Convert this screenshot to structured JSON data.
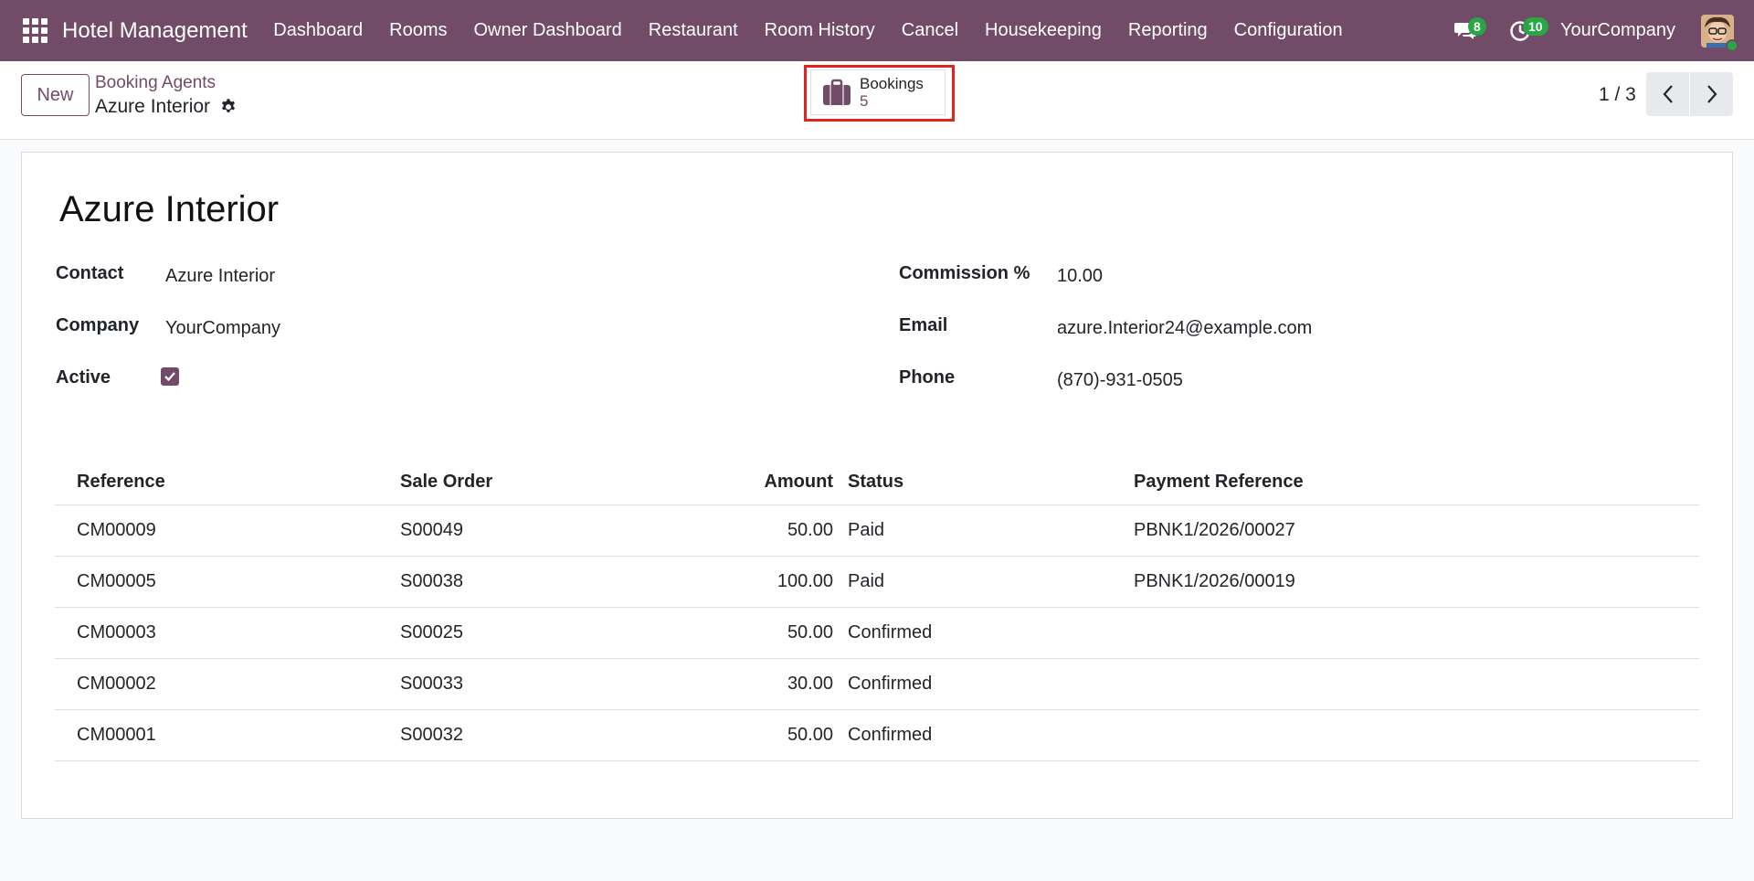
{
  "navbar": {
    "app_name": "Hotel Management",
    "menu": [
      "Dashboard",
      "Rooms",
      "Owner Dashboard",
      "Restaurant",
      "Room History",
      "Cancel",
      "Housekeeping",
      "Reporting",
      "Configuration"
    ],
    "messages_count": "8",
    "activities_count": "10",
    "company": "YourCompany"
  },
  "control_panel": {
    "new_label": "New",
    "breadcrumb_parent": "Booking Agents",
    "breadcrumb_current": "Azure Interior",
    "smart_button": {
      "label": "Bookings",
      "count": "5",
      "icon": "briefcase-icon"
    },
    "pager": "1 / 3"
  },
  "form": {
    "title": "Azure Interior",
    "contact_label": "Contact",
    "contact_value": "Azure Interior",
    "company_label": "Company",
    "company_value": "YourCompany",
    "active_label": "Active",
    "active_value": true,
    "commission_label": "Commission %",
    "commission_value": "10.00",
    "email_label": "Email",
    "email_value": "azure.Interior24@example.com",
    "phone_label": "Phone",
    "phone_value": "(870)-931-0505"
  },
  "table": {
    "headers": {
      "reference": "Reference",
      "sale_order": "Sale Order",
      "amount": "Amount",
      "status": "Status",
      "payment_reference": "Payment Reference"
    },
    "rows": [
      {
        "reference": "CM00009",
        "sale_order": "S00049",
        "amount": "50.00",
        "status": "Paid",
        "payment_reference": "PBNK1/2026/00027"
      },
      {
        "reference": "CM00005",
        "sale_order": "S00038",
        "amount": "100.00",
        "status": "Paid",
        "payment_reference": "PBNK1/2026/00019"
      },
      {
        "reference": "CM00003",
        "sale_order": "S00025",
        "amount": "50.00",
        "status": "Confirmed",
        "payment_reference": ""
      },
      {
        "reference": "CM00002",
        "sale_order": "S00033",
        "amount": "30.00",
        "status": "Confirmed",
        "payment_reference": ""
      },
      {
        "reference": "CM00001",
        "sale_order": "S00032",
        "amount": "50.00",
        "status": "Confirmed",
        "payment_reference": ""
      }
    ]
  },
  "colors": {
    "brand": "#714b67",
    "badge": "#28a745",
    "highlight": "#e02424"
  }
}
